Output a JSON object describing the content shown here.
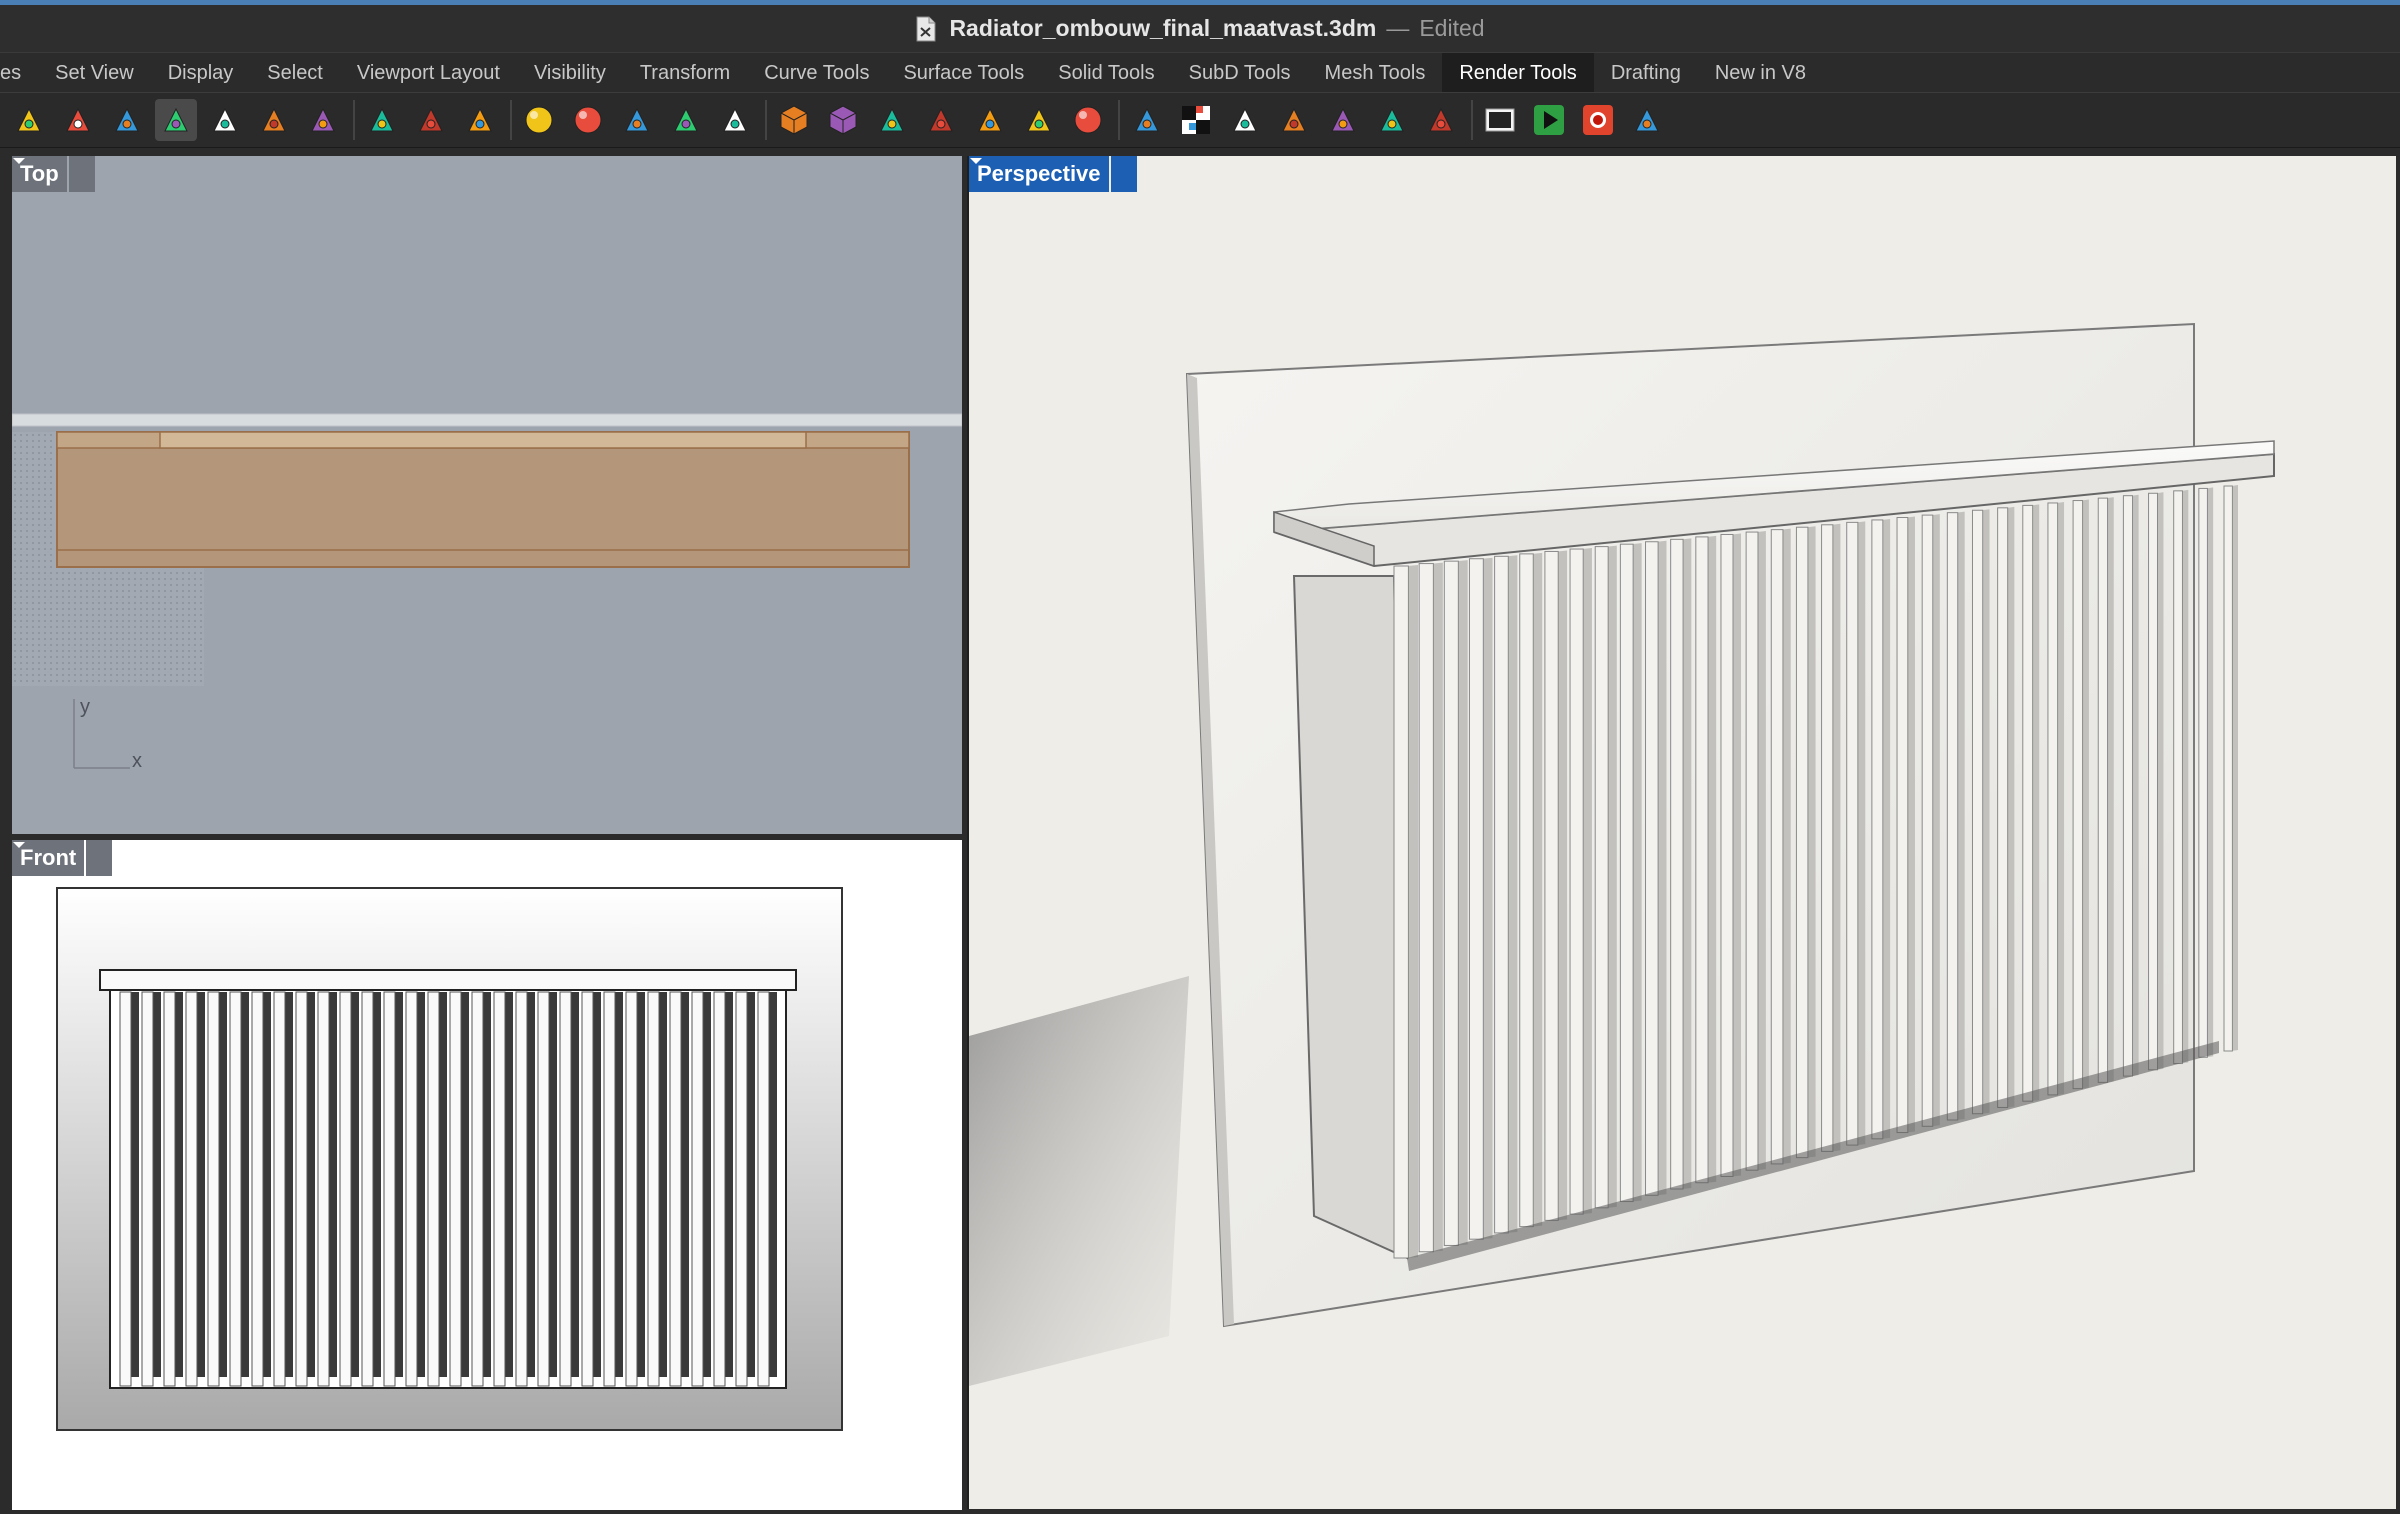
{
  "window": {
    "file_name": "Radiator_ombouw_final_maatvast.3dm",
    "separator": "—",
    "state": "Edited",
    "file_icon": "document-icon"
  },
  "tabs": [
    {
      "label": "es",
      "active": false
    },
    {
      "label": "Set View",
      "active": false
    },
    {
      "label": "Display",
      "active": false
    },
    {
      "label": "Select",
      "active": false
    },
    {
      "label": "Viewport Layout",
      "active": false
    },
    {
      "label": "Visibility",
      "active": false
    },
    {
      "label": "Transform",
      "active": false
    },
    {
      "label": "Curve Tools",
      "active": false
    },
    {
      "label": "Surface Tools",
      "active": false
    },
    {
      "label": "Solid Tools",
      "active": false
    },
    {
      "label": "SubD Tools",
      "active": false
    },
    {
      "label": "Mesh Tools",
      "active": false
    },
    {
      "label": "Render Tools",
      "active": true
    },
    {
      "label": "Drafting",
      "active": false
    },
    {
      "label": "New in V8",
      "active": false
    }
  ],
  "toolbar_icons": [
    "spotlight-icon",
    "point-light-icon",
    "directional-light-icon",
    "rectangular-light-icon",
    "linear-light-icon",
    "light-properties-icon",
    "sun-icon",
    "sep",
    "pick-material-icon",
    "assign-material-icon",
    "match-material-icon",
    "sep",
    "material-sphere-icon",
    "materials-panel-icon",
    "environment-icon",
    "decal-icon",
    "texture-mapping-icon",
    "sep",
    "box-mapping-icon",
    "cube-map-icon",
    "ground-plane-icon",
    "curved-backdrop-icon",
    "render-mesh-icon",
    "rounded-box-icon",
    "bump-texture-icon",
    "sep",
    "edit-texture-icon",
    "checker-texture-icon",
    "dome-icon",
    "key-light-icon",
    "grid-texture-icon",
    "ruler-icon",
    "explode-icon",
    "sep",
    "render-window-icon",
    "render-play-icon",
    "record-icon",
    "render-settings-icon"
  ],
  "viewports": {
    "top": {
      "label": "Top",
      "axis_y": "y",
      "axis_x": "x"
    },
    "front": {
      "label": "Front"
    },
    "perspective": {
      "label": "Perspective"
    }
  },
  "colors": {
    "accent": "#1d5fb3",
    "wood": "#b4967a",
    "top_background": "#9ea4ae"
  }
}
